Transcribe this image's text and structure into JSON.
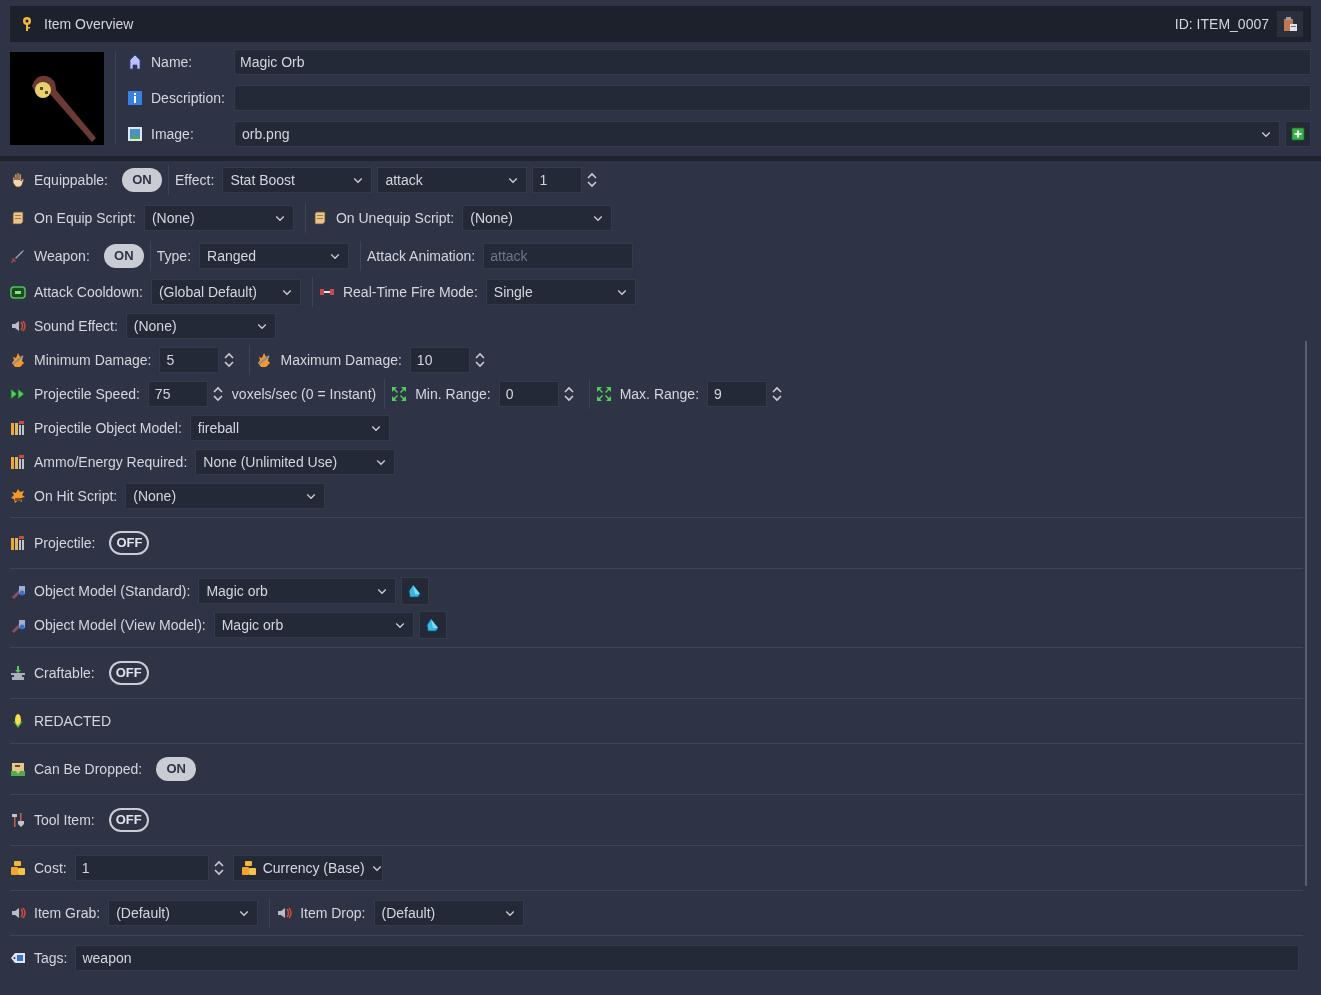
{
  "header": {
    "title": "Item Overview",
    "id": "ID: ITEM_0007"
  },
  "details": [
    {
      "kind": "text",
      "label": "Name:",
      "value": "Magic Orb"
    },
    {
      "kind": "text",
      "label": "Description:"
    },
    {
      "kind": "select",
      "label": "Image:",
      "value": "orb.png"
    }
  ],
  "groups": [
    [
      [
        {
          "kind": "label",
          "text": "Equippable:"
        },
        {
          "kind": "toggle",
          "text": "ON",
          "on": true
        },
        {
          "kind": "divider"
        },
        {
          "kind": "label",
          "text": "Effect:"
        },
        {
          "kind": "select",
          "value": "Stat Boost"
        },
        {
          "kind": "select",
          "value": "attack"
        },
        {
          "kind": "spin",
          "value": "1"
        }
      ],
      [
        {
          "kind": "label",
          "text": "On Equip Script:"
        },
        {
          "kind": "select",
          "value": "(None)"
        },
        {
          "kind": "divider"
        },
        {
          "kind": "label",
          "text": "On Unequip Script:"
        },
        {
          "kind": "select",
          "value": "(None)"
        }
      ],
      [
        {
          "kind": "label",
          "text": "Weapon:"
        },
        {
          "kind": "toggle",
          "text": "ON",
          "on": true
        },
        {
          "kind": "divider"
        },
        {
          "kind": "label",
          "text": "Type:"
        },
        {
          "kind": "select",
          "value": "Ranged"
        },
        {
          "kind": "divider"
        },
        {
          "kind": "label",
          "text": "Attack Animation:"
        },
        {
          "kind": "text",
          "placeholder": "attack"
        }
      ],
      [
        {
          "kind": "label",
          "text": "Attack Cooldown:"
        },
        {
          "kind": "select",
          "value": "(Global Default)"
        },
        {
          "kind": "divider"
        },
        {
          "kind": "label",
          "text": "Real-Time Fire Mode:"
        },
        {
          "kind": "select",
          "value": "Single"
        }
      ],
      [
        {
          "kind": "label",
          "text": "Sound Effect:"
        },
        {
          "kind": "select",
          "value": "(None)"
        }
      ],
      [
        {
          "kind": "label",
          "text": "Minimum Damage:"
        },
        {
          "kind": "spin",
          "value": "5"
        },
        {
          "kind": "divider"
        },
        {
          "kind": "label",
          "text": "Maximum Damage:"
        },
        {
          "kind": "spin",
          "value": "10"
        }
      ],
      [
        {
          "kind": "label",
          "text": "Projectile Speed:"
        },
        {
          "kind": "spin",
          "value": "75"
        },
        {
          "kind": "note",
          "text": "voxels/sec (0 = Instant)"
        },
        {
          "kind": "divider"
        },
        {
          "kind": "label",
          "text": "Min. Range:"
        },
        {
          "kind": "spin",
          "value": "0"
        },
        {
          "kind": "divider"
        },
        {
          "kind": "label",
          "text": "Max. Range:"
        },
        {
          "kind": "spin",
          "value": "9"
        }
      ],
      [
        {
          "kind": "label",
          "text": "Projectile Object Model:"
        },
        {
          "kind": "select",
          "value": "fireball"
        }
      ],
      [
        {
          "kind": "label",
          "text": "Ammo/Energy Required:"
        },
        {
          "kind": "select",
          "value": "None (Unlimited Use)"
        }
      ],
      [
        {
          "kind": "label",
          "text": "On Hit Script:"
        },
        {
          "kind": "select",
          "value": "(None)"
        }
      ]
    ],
    [
      [
        {
          "kind": "label",
          "text": "Projectile:"
        },
        {
          "kind": "toggle",
          "text": "OFF",
          "on": false
        }
      ]
    ],
    [
      [
        {
          "kind": "label",
          "text": "Object Model (Standard):"
        },
        {
          "kind": "select",
          "value": "Magic orb"
        },
        {
          "kind": "picker"
        }
      ],
      [
        {
          "kind": "label",
          "text": "Object Model (View Model):"
        },
        {
          "kind": "select",
          "value": "Magic orb"
        },
        {
          "kind": "picker"
        }
      ]
    ],
    [
      [
        {
          "kind": "label",
          "text": "Craftable:"
        },
        {
          "kind": "toggle",
          "text": "OFF",
          "on": false
        }
      ]
    ],
    [
      [
        {
          "kind": "label",
          "text": "REDACTED"
        }
      ]
    ],
    [
      [
        {
          "kind": "label",
          "text": "Can Be Dropped:"
        },
        {
          "kind": "toggle",
          "text": "ON",
          "on": true
        }
      ]
    ],
    [
      [
        {
          "kind": "label",
          "text": "Tool Item:"
        },
        {
          "kind": "toggle",
          "text": "OFF",
          "on": false
        }
      ]
    ],
    [
      [
        {
          "kind": "label",
          "text": "Cost:"
        },
        {
          "kind": "spin",
          "value": "1"
        },
        {
          "kind": "select",
          "value": "Currency (Base)"
        }
      ]
    ],
    [
      [
        {
          "kind": "label",
          "text": "Item Grab:"
        },
        {
          "kind": "select",
          "value": "(Default)"
        },
        {
          "kind": "divider"
        },
        {
          "kind": "label",
          "text": "Item Drop:"
        },
        {
          "kind": "select",
          "value": "(Default)"
        }
      ]
    ],
    [
      [
        {
          "kind": "label",
          "text": "Tags:"
        },
        {
          "kind": "text",
          "value": "weapon"
        }
      ]
    ]
  ]
}
